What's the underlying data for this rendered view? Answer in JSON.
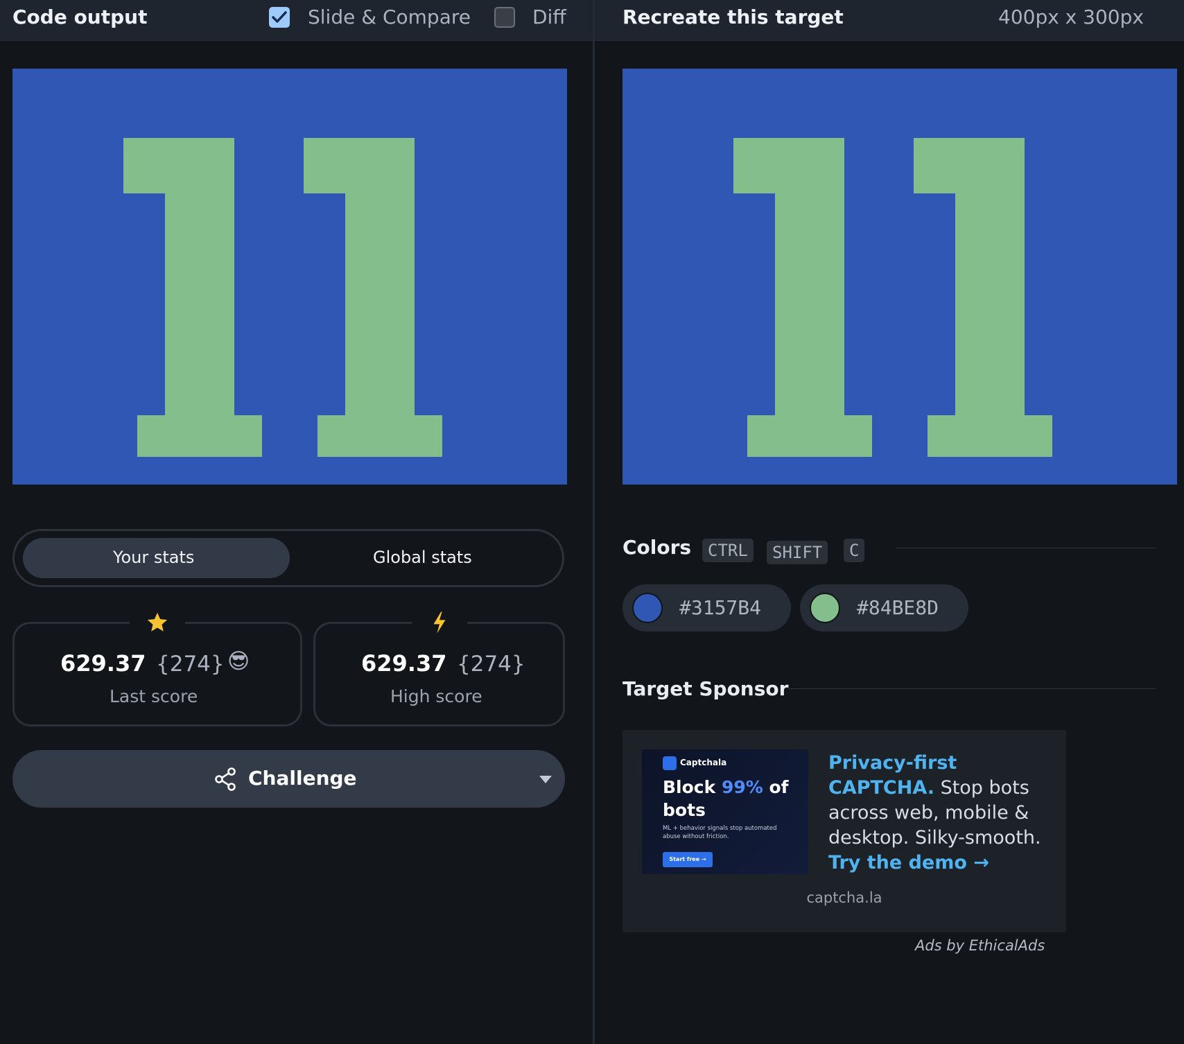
{
  "header_left": {
    "title": "Code output",
    "slide_compare_label": "Slide & Compare",
    "slide_compare_checked": true,
    "diff_label": "Diff",
    "diff_checked": false
  },
  "header_right": {
    "title": "Recreate this target",
    "dimensions": "400px x 300px"
  },
  "canvas": {
    "background_color": "#3157B4",
    "foreground_color": "#84BE8D",
    "glyphs": "11"
  },
  "stats": {
    "tabs": [
      {
        "label": "Your stats",
        "active": true
      },
      {
        "label": "Global stats",
        "active": false
      }
    ],
    "last": {
      "icon": "star-icon",
      "score": "629.37",
      "count": "{274}",
      "emoji": "😎",
      "caption": "Last score"
    },
    "high": {
      "icon": "lightning-icon",
      "score": "629.37",
      "count": "{274}",
      "caption": "High score"
    }
  },
  "challenge": {
    "label": "Challenge",
    "icon": "share-icon"
  },
  "colors_section": {
    "title": "Colors",
    "shortcut": [
      "CTRL",
      "SHIFT",
      "C"
    ],
    "swatches": [
      {
        "hex": "#3157B4"
      },
      {
        "hex": "#84BE8D"
      }
    ]
  },
  "sponsor": {
    "title": "Target Sponsor",
    "image": {
      "brand": "Captchala",
      "headline_pre": "Block ",
      "headline_accent": "99%",
      "headline_post": " of",
      "headline_line2": "bots",
      "subtext": "ML + behavior signals stop automated abuse without friction.",
      "cta": "Start free →"
    },
    "text_highlight": "Privacy-first CAPTCHA.",
    "text_body": " Stop bots across web, mobile & desktop. Silky-smooth. ",
    "text_cta": "Try the demo →",
    "domain": "captcha.la",
    "footer": "Ads by EthicalAds"
  }
}
